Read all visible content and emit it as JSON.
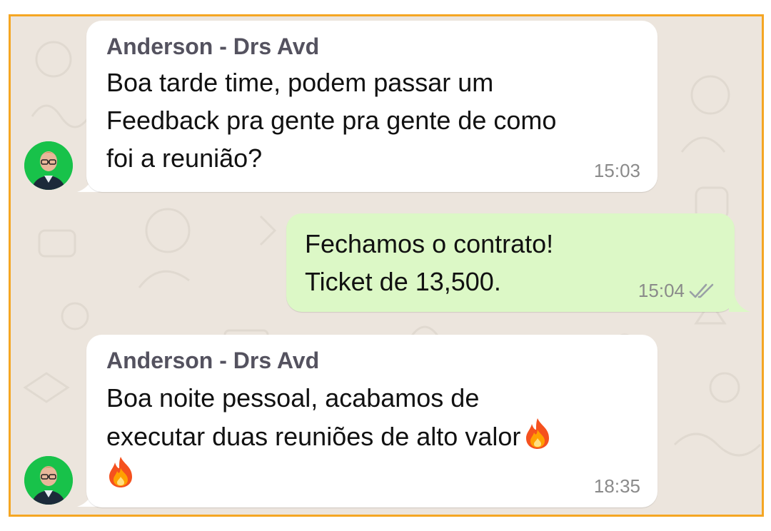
{
  "chat": {
    "messages": [
      {
        "direction": "incoming",
        "sender": "Anderson - Drs Avd",
        "lines": [
          "Boa tarde time, podem passar um",
          "Feedback pra gente pra gente de como",
          "foi a reunião?"
        ],
        "time": "15:03"
      },
      {
        "direction": "outgoing",
        "lines": [
          "Fechamos o contrato!",
          "Ticket de 13,500."
        ],
        "time": "15:04",
        "status_icon": "double-check-icon"
      },
      {
        "direction": "incoming",
        "sender": "Anderson - Drs Avd",
        "lines": [
          "Boa noite pessoal, acabamos de",
          "executar duas reuniões de alto valor",
          ""
        ],
        "emojis": [
          "fire-emoji",
          "fire-emoji"
        ],
        "time": "18:35"
      }
    ]
  },
  "colors": {
    "frame_border": "#f5a623",
    "chat_background": "#ece5dd",
    "incoming_bubble": "#ffffff",
    "outgoing_bubble": "#dcf8c6",
    "sender_name": "#54525f",
    "timestamp": "#8a8a8a",
    "avatar_background": "#18c24a"
  }
}
